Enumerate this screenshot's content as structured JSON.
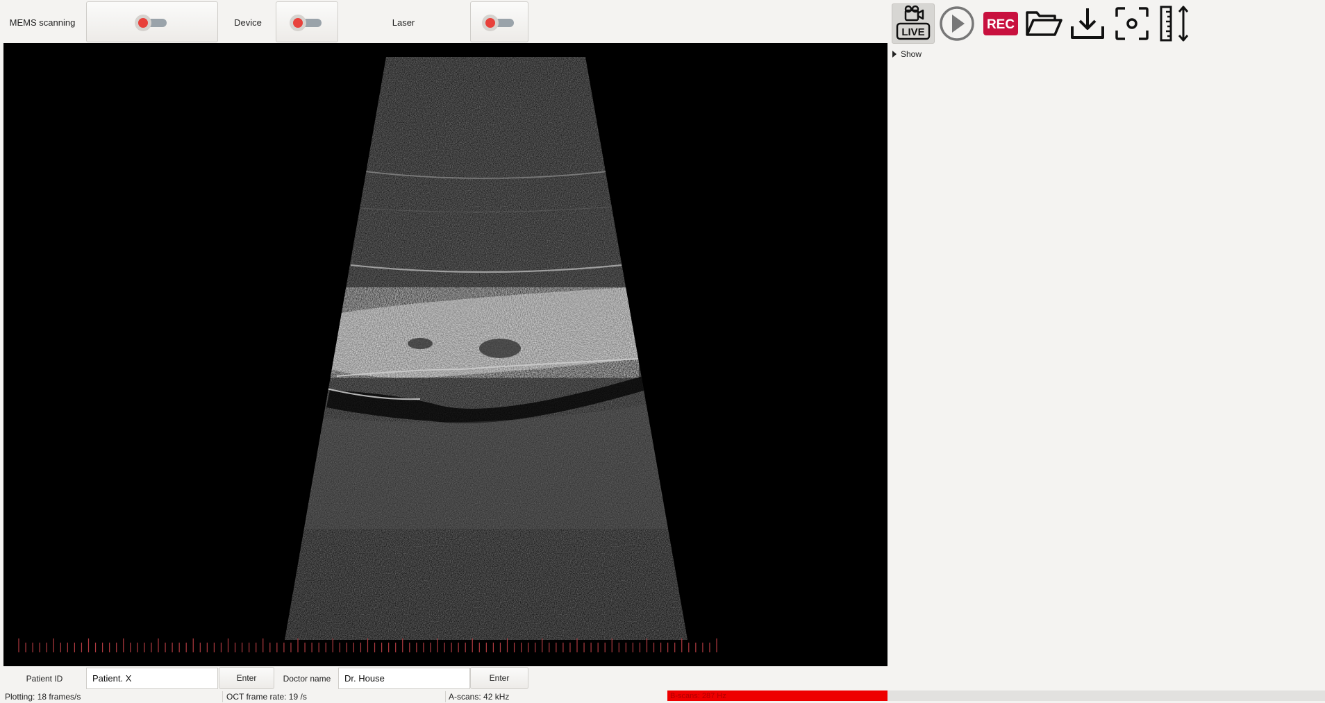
{
  "controls": {
    "mems_label": "MEMS scanning",
    "device_label": "Device",
    "laser_label": "Laser"
  },
  "toolbar": {
    "live_label": "LIVE",
    "rec_label": "REC",
    "accent_rec": "#c8103e"
  },
  "panel": {
    "show_label": "Show"
  },
  "patient": {
    "id_label": "Patient ID",
    "id_value": "Patient. X",
    "enter_label": "Enter",
    "doctor_label": "Doctor name",
    "doctor_value": "Dr. House",
    "doctor_enter_label": "Enter"
  },
  "status": {
    "plotting": "Plotting: 18 frames/s",
    "oct_rate": "OCT frame rate: 19 /s",
    "ascans": "A-scans: 42 kHz",
    "bscans": "B-scans: 287 Hz"
  }
}
